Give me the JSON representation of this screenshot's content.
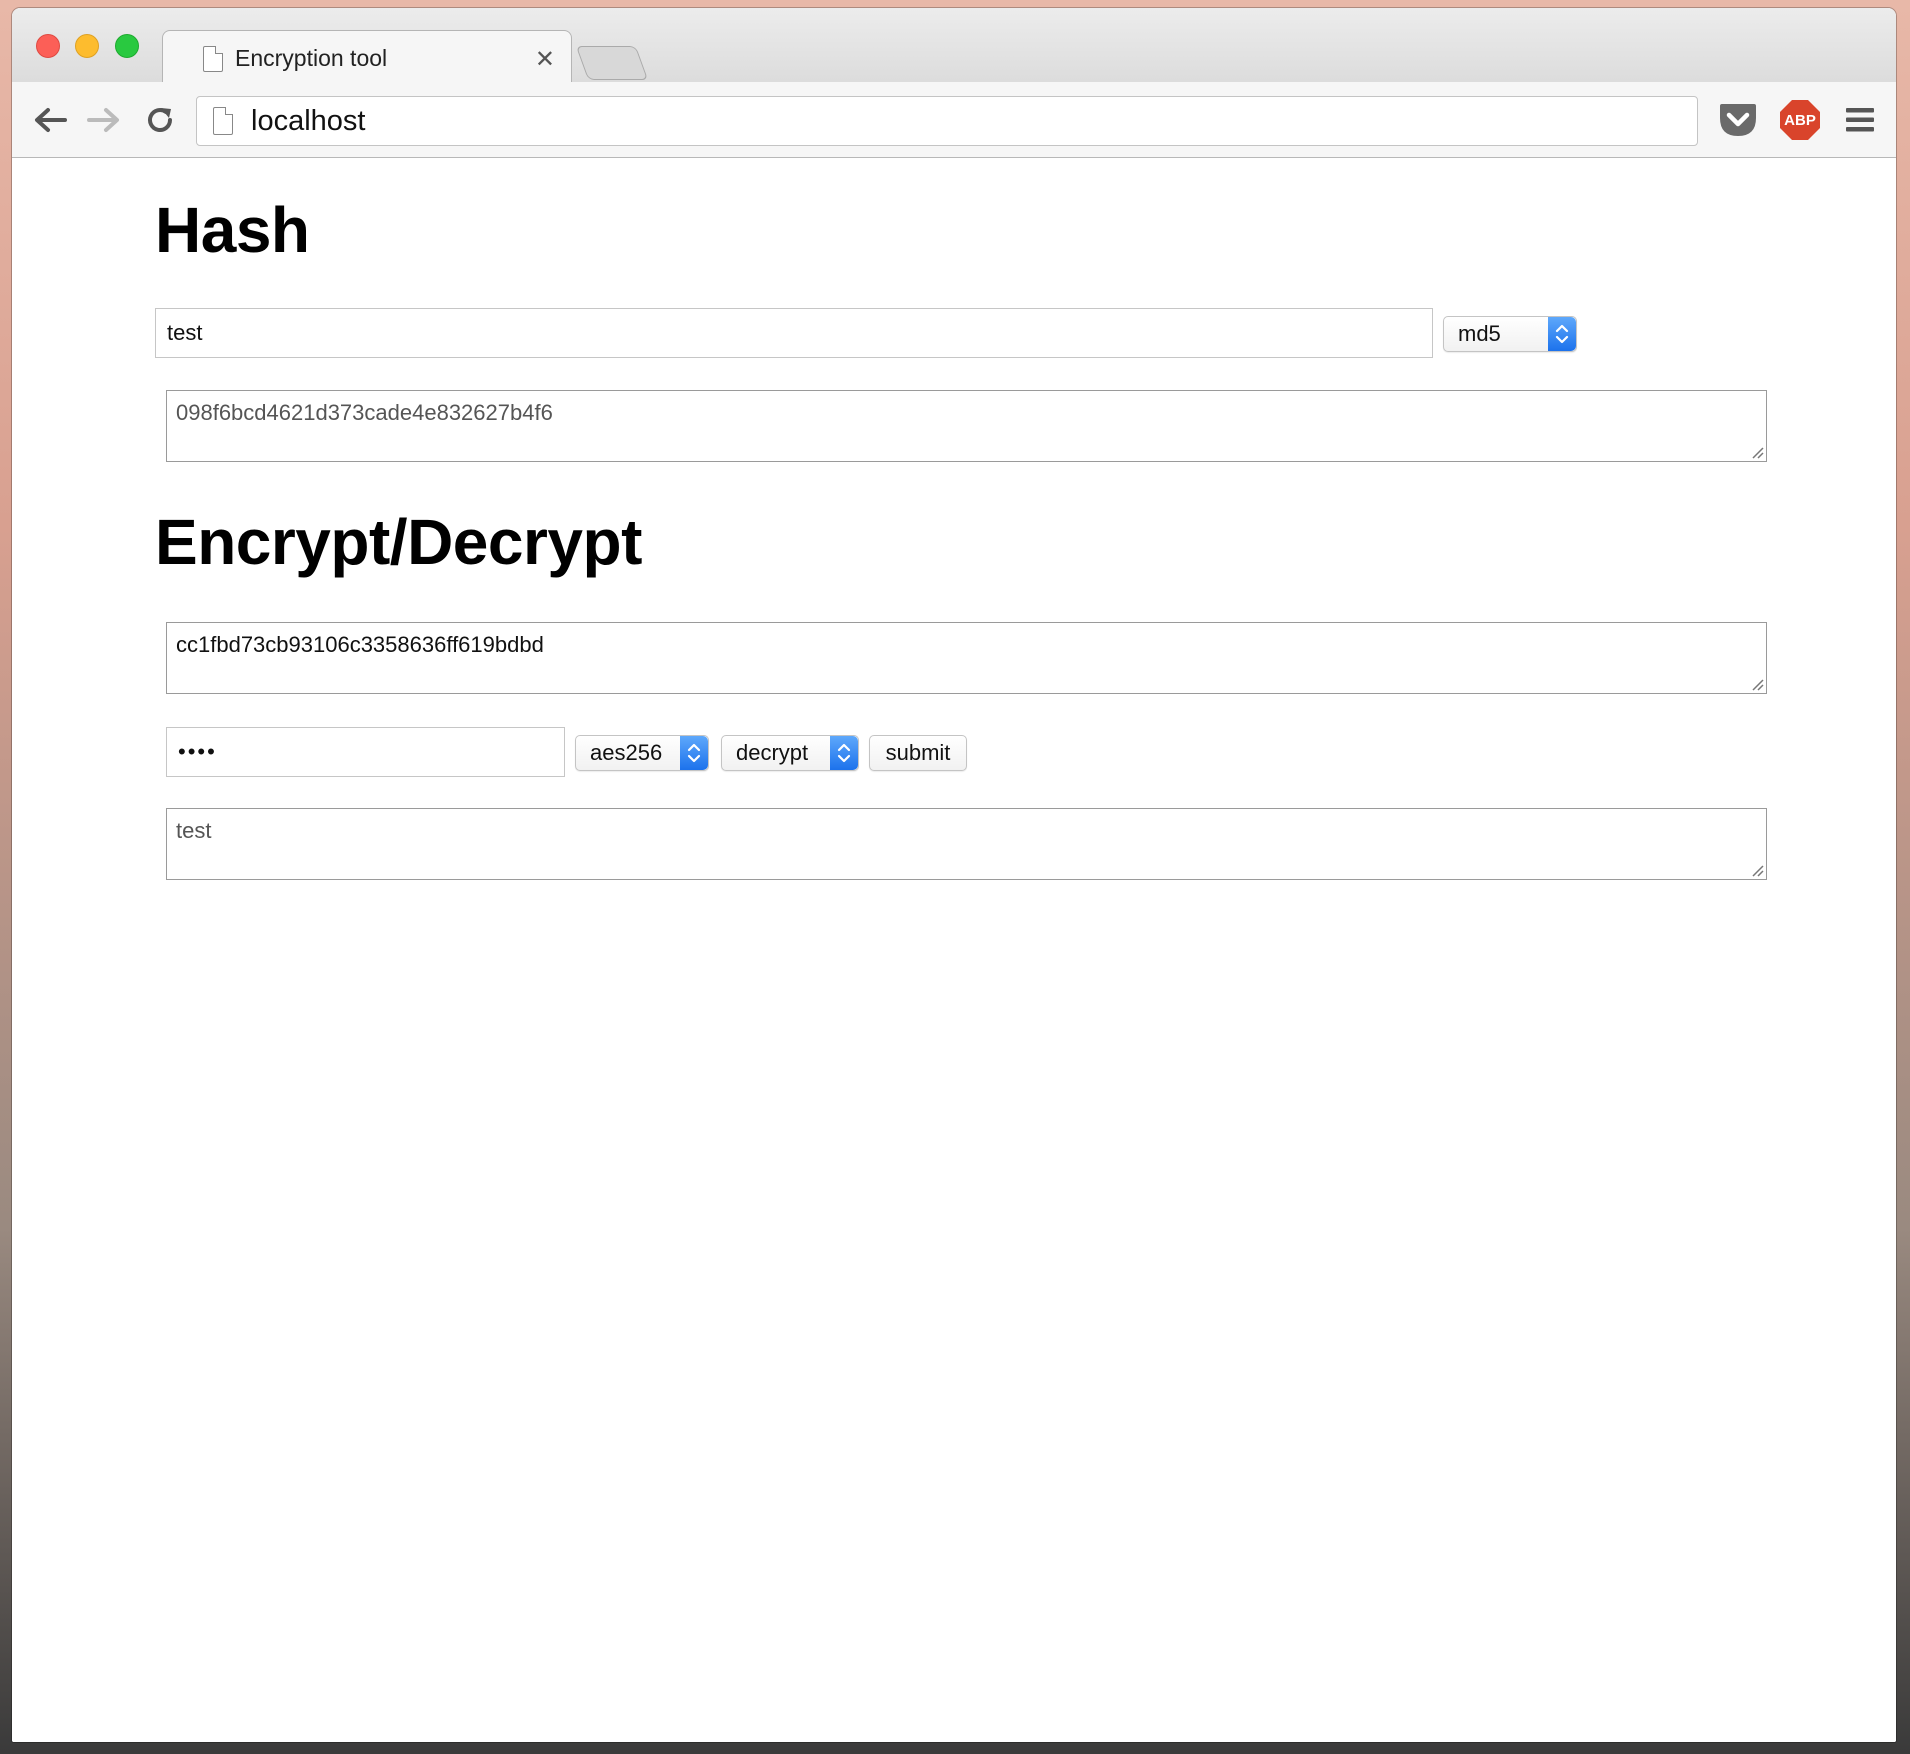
{
  "browser": {
    "tab_title": "Encryption tool",
    "tab_close": "✕",
    "url": "localhost",
    "abp_label": "ABP"
  },
  "hash": {
    "heading": "Hash",
    "input_value": "test",
    "algorithm": "md5",
    "output": "098f6bcd4621d373cade4e832627b4f6"
  },
  "crypt": {
    "heading": "Encrypt/Decrypt",
    "input": "cc1fbd73cb93106c3358636ff619bdbd",
    "password_mask": "••••",
    "cipher": "aes256",
    "mode": "decrypt",
    "submit_label": "submit",
    "output": "test"
  },
  "colors": {
    "close": "#fc5f57",
    "minimize": "#fdbc2e",
    "maximize": "#29c940",
    "select_accent": "#1c72ec",
    "abp": "#d9442b"
  }
}
